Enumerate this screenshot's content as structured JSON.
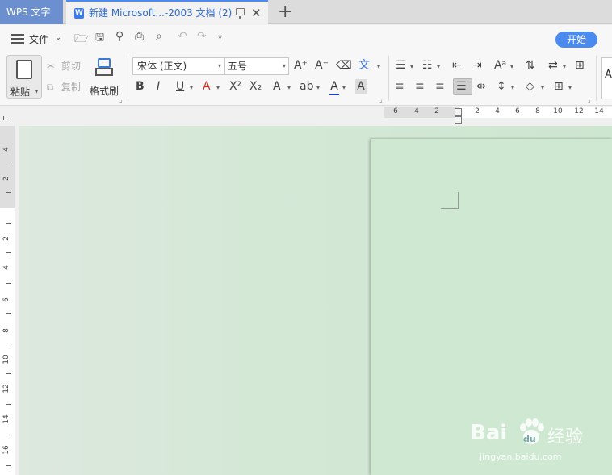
{
  "titlebar": {
    "app_name": "WPS 文字",
    "doc_tab_title": "新建 Microsoft...-2003 文档 (2)",
    "doc_icon_letter": "W",
    "close_glyph": "✕",
    "new_tab_glyph": "+"
  },
  "menubar": {
    "file_label": "文件",
    "start_button": "开始"
  },
  "ribbon": {
    "paste_label": "粘贴",
    "cut_label": "剪切",
    "copy_label": "复制",
    "format_painter_label": "格式刷",
    "font_name": "宋体 (正文)",
    "font_size": "五号",
    "style_preview": "Aa"
  },
  "rulers": {
    "horizontal_ticks": [
      "6",
      "4",
      "2",
      "2",
      "4",
      "6",
      "8",
      "10",
      "12",
      "14"
    ],
    "vertical_ticks": [
      "4",
      "2",
      "2",
      "4",
      "6",
      "8",
      "10",
      "12",
      "14",
      "16"
    ]
  },
  "watermark": {
    "brand": "Bai",
    "brand_suffix": "du",
    "chinese": "经验",
    "url": "jingyan.baidu.com"
  },
  "colors": {
    "accent": "#4b8bf0",
    "app_tab": "#6b8fcf",
    "canvas": "#d4e8d6",
    "page": "#cfe8d1"
  }
}
